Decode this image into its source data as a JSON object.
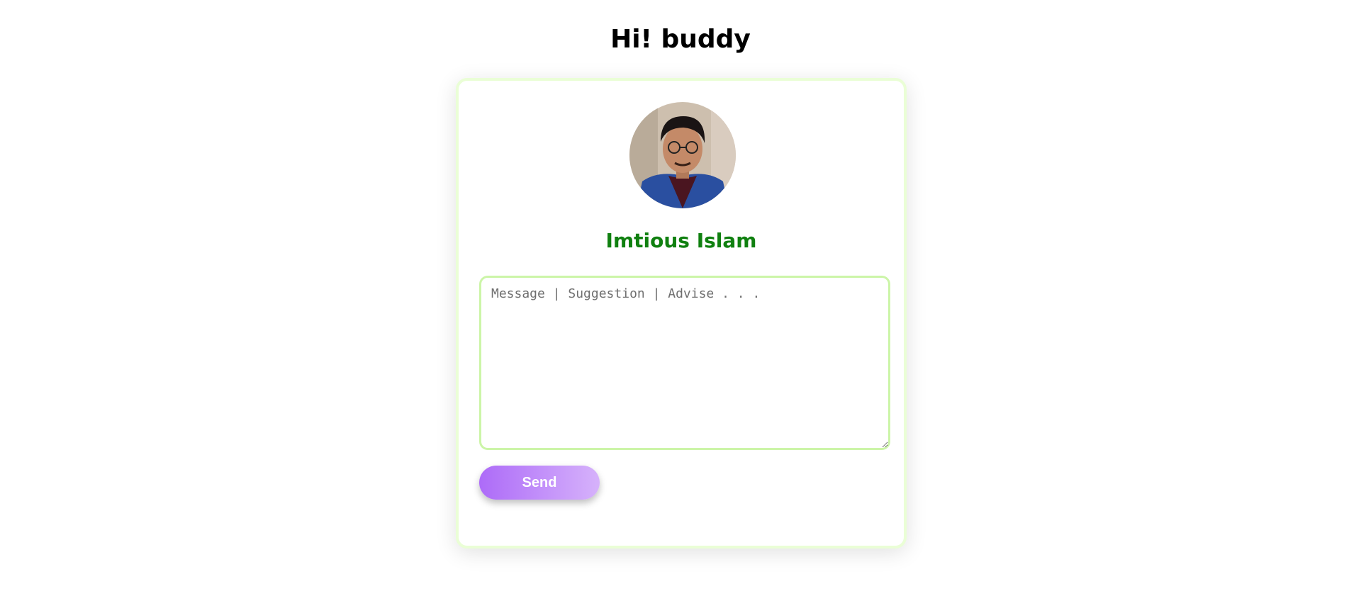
{
  "header": {
    "title": "Hi! buddy"
  },
  "profile": {
    "name": "Imtious Islam",
    "name_color": "#108010",
    "avatar_icon": "profile-photo"
  },
  "form": {
    "message_placeholder": "Message | Suggestion | Advise . . .",
    "message_value": "",
    "send_label": "Send",
    "send_gradient": [
      "#ad6bf8",
      "#d6b2fb"
    ]
  },
  "colors": {
    "card_border": "#eafed6",
    "textarea_border": "#ccf5a8"
  }
}
